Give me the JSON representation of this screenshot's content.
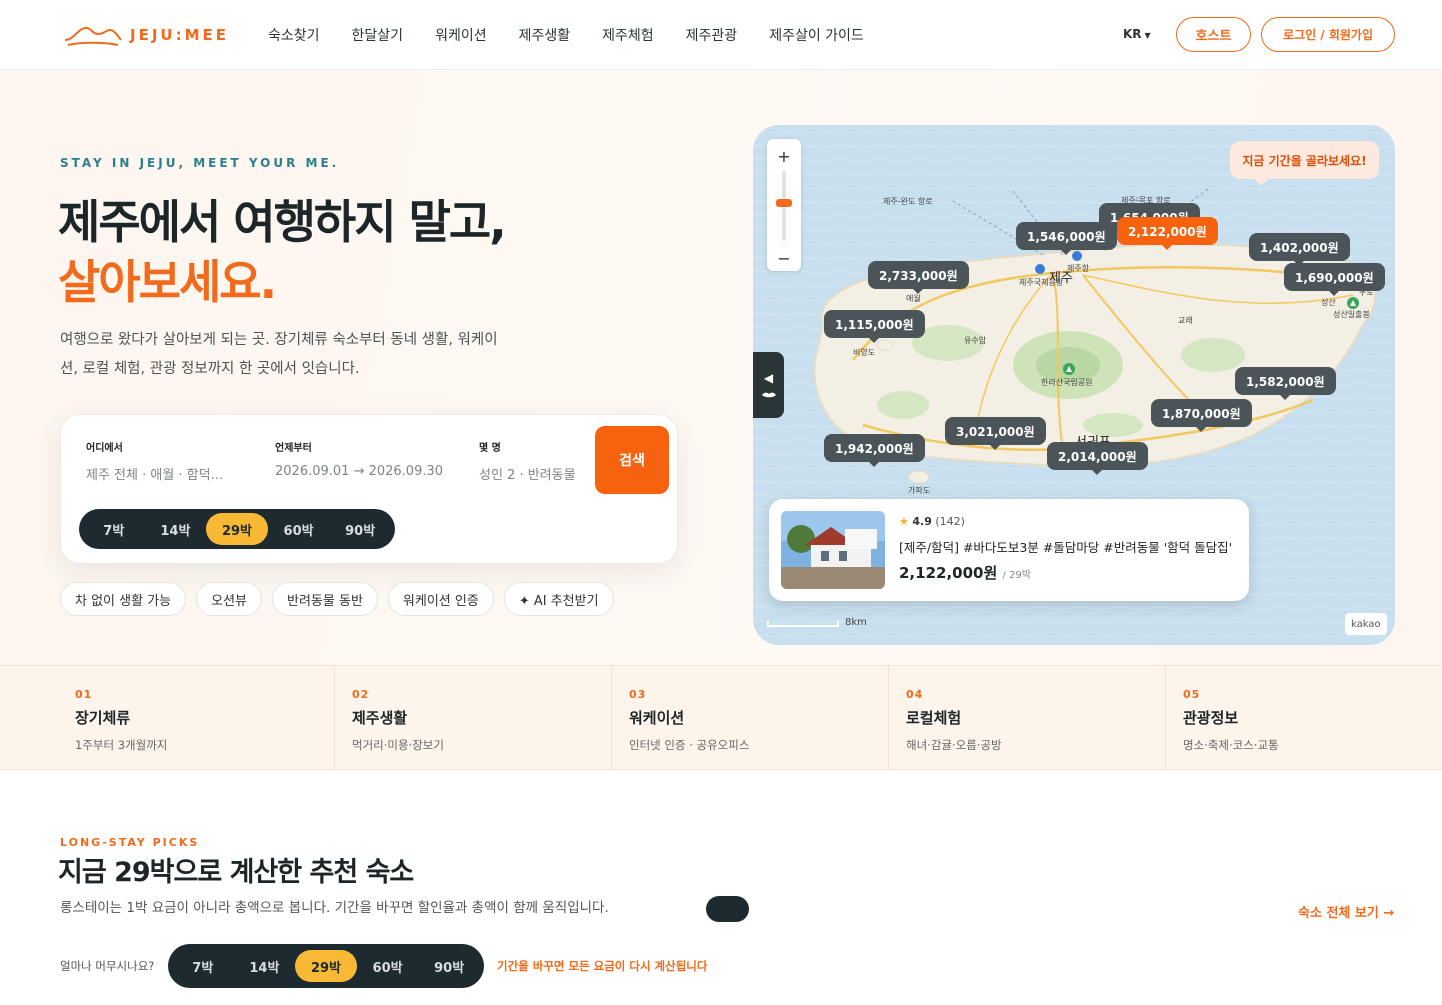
{
  "header": {
    "logo_text": "JEJU:MEE",
    "nav": [
      "숙소찾기",
      "한달살기",
      "워케이션",
      "제주생활",
      "제주체험",
      "제주관광",
      "제주살이 가이드"
    ],
    "lang": "KR",
    "host_label": "호스트",
    "login_label": "로그인 / 회원가입",
    "accent": "#f26a1b"
  },
  "hero": {
    "tagline": "STAY IN JEJU, MEET YOUR ME.",
    "title_line1": "제주에서 여행하지 말고,",
    "title_line2": "살아보세요.",
    "desc": "여행으로 왔다가 살아보게 되는 곳. 장기체류 숙소부터 동네 생활, 워케이션, 로컬 체험, 관광 정보까지 한 곳에서 잇습니다."
  },
  "search": {
    "where_label": "어디에서",
    "where_value": "제주 전체 · 애월 · 함덕...",
    "when_label": "언제부터",
    "when_value": "2026.09.01 → 2026.09.30",
    "guests_label": "몇 명",
    "guests_value": "성인 2 · 반려동물",
    "search_button": "검색",
    "nights": [
      "7박",
      "14박",
      "29박",
      "60박",
      "90박"
    ],
    "active_night": "29박"
  },
  "chips": [
    "차 없이 생활 가능",
    "오션뷰",
    "반려동물 동반",
    "워케이션 인증",
    "✦ AI 추천받기"
  ],
  "map": {
    "hint": "지금 기간을 골라보세요!",
    "zoom_in": "+",
    "zoom_out": "−",
    "pins": [
      {
        "price": "1,654,000원"
      },
      {
        "price": "1,546,000원"
      },
      {
        "price": "2,122,000원"
      },
      {
        "price": "1,402,000원"
      },
      {
        "price": "2,733,000원"
      },
      {
        "price": "1,690,000원"
      },
      {
        "price": "1,115,000원"
      },
      {
        "price": "1,582,000원"
      },
      {
        "price": "1,870,000원"
      },
      {
        "price": "3,021,000원"
      },
      {
        "price": "1,942,000원"
      },
      {
        "price": "2,014,000원"
      }
    ],
    "labels": [
      "제주-완도 항로",
      "제주-목포 항로",
      "제주",
      "제주국제공항",
      "제주항",
      "애월",
      "비양도",
      "유수암",
      "한라산국립공원",
      "교래",
      "성산",
      "우도",
      "성산일출봉",
      "서귀포",
      "가파도"
    ],
    "card": {
      "rating": "4.9",
      "reviews": "(142)",
      "title": "[제주/함덕] #바다도보3분 #돌담마당 #반려동물 '함덕 돌담집'",
      "price": "2,122,000원",
      "per": "/ 29박"
    },
    "scale": "8km",
    "provider": "kakao"
  },
  "categories": [
    {
      "num": "01",
      "title": "장기체류",
      "sub": "1주부터 3개월까지"
    },
    {
      "num": "02",
      "title": "제주생활",
      "sub": "먹거리·미용·장보기"
    },
    {
      "num": "03",
      "title": "워케이션",
      "sub": "인터넷 인증 · 공유오피스"
    },
    {
      "num": "04",
      "title": "로컬체험",
      "sub": "해녀·감귤·오름·공방"
    },
    {
      "num": "05",
      "title": "관광정보",
      "sub": "명소·축제·코스·교통"
    }
  ],
  "picks": {
    "eyebrow": "LONG-STAY PICKS",
    "title": "지금 29박으로 계산한 추천 숙소",
    "desc": "롱스테이는 1박 요금이 아니라 총액으로 봅니다. 기간을 바꾸면 할인율과 총액이 함께 움직입니다.",
    "see_all": "숙소 전체 보기 →",
    "stay_question": "얼마나 머무시나요?",
    "recalc_note": "기간을 바꾸면 모든 요금이 다시 계산됩니다"
  }
}
